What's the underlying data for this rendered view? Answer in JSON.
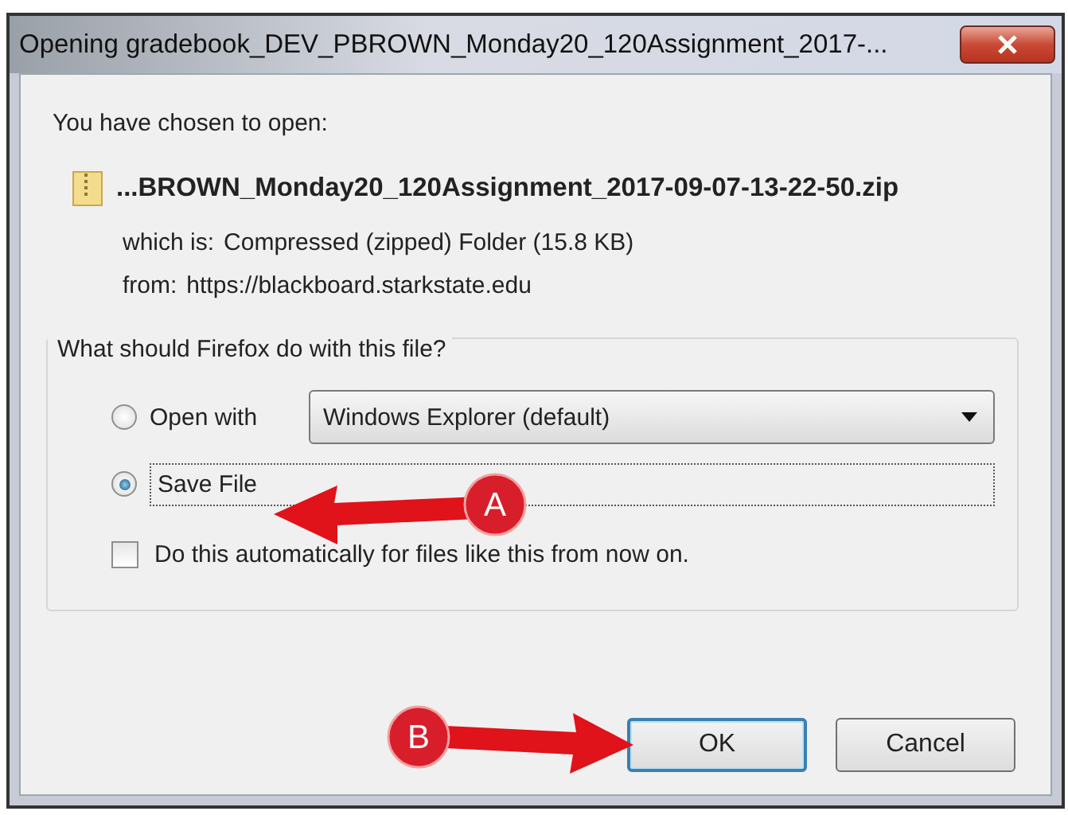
{
  "window": {
    "title": "Opening gradebook_DEV_PBROWN_Monday20_120Assignment_2017-..."
  },
  "intro": "You have chosen to open:",
  "file": {
    "name": "...BROWN_Monday20_120Assignment_2017-09-07-13-22-50.zip",
    "details": [
      {
        "label": "which is:",
        "value": "Compressed (zipped) Folder (15.8 KB)"
      },
      {
        "label": "from:",
        "value": "https://blackboard.starkstate.edu"
      }
    ]
  },
  "action_group": {
    "legend": "What should Firefox do with this file?",
    "options": [
      {
        "kind": "radio-with-select",
        "label": "Open with",
        "selected": false,
        "select_value": "Windows Explorer (default)"
      },
      {
        "kind": "radio",
        "label": "Save File",
        "selected": true
      }
    ],
    "auto_checkbox": {
      "label": "Do this automatically for files like this from now on.",
      "checked": false
    }
  },
  "buttons": [
    {
      "label": "OK",
      "default": true
    },
    {
      "label": "Cancel",
      "default": false
    }
  ],
  "callouts": [
    {
      "letter": "A"
    },
    {
      "letter": "B"
    }
  ]
}
